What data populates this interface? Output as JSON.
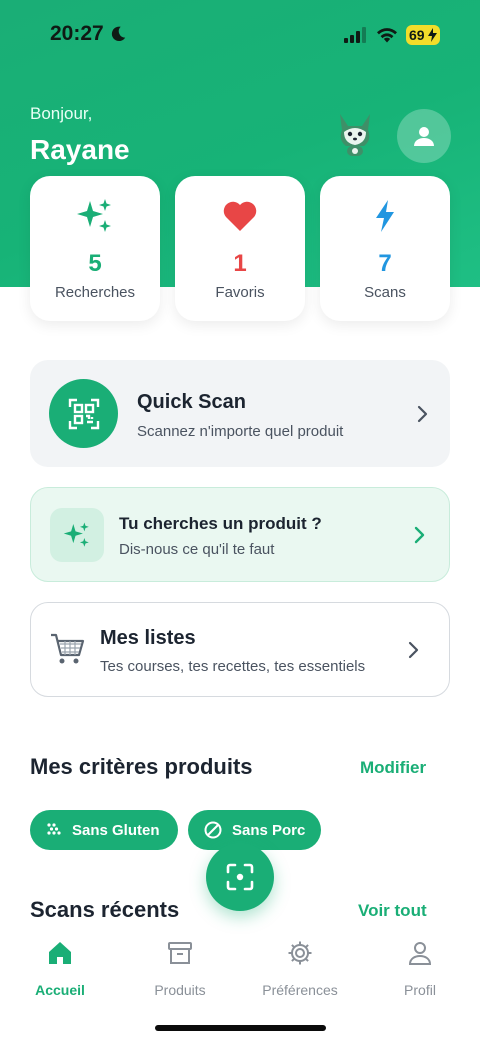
{
  "status_bar": {
    "time": "20:27",
    "battery": "69"
  },
  "header": {
    "greeting": "Bonjour,",
    "username": "Rayane"
  },
  "stats": [
    {
      "value": "5",
      "label": "Recherches",
      "icon": "sparkles-icon",
      "color": "#1aae76"
    },
    {
      "value": "1",
      "label": "Favoris",
      "icon": "heart-icon",
      "color": "#e84646"
    },
    {
      "value": "7",
      "label": "Scans",
      "icon": "lightning-icon",
      "color": "#2196e0"
    }
  ],
  "quick_scan": {
    "title": "Quick Scan",
    "subtitle": "Scannez n'importe quel produit"
  },
  "ask_product": {
    "title": "Tu cherches un produit ?",
    "subtitle": "Dis-nous ce qu'il te faut"
  },
  "my_lists": {
    "title": "Mes listes",
    "subtitle": "Tes courses, tes recettes, tes essentiels"
  },
  "criteria": {
    "title": "Mes critères produits",
    "edit_label": "Modifier",
    "chips": [
      {
        "label": "Sans Gluten",
        "icon": "gluten-free-icon"
      },
      {
        "label": "Sans Porc",
        "icon": "no-symbol-icon"
      }
    ]
  },
  "recent_scans": {
    "title": "Scans récents",
    "see_all_label": "Voir tout"
  },
  "tabs": [
    {
      "label": "Accueil",
      "icon": "home-icon",
      "active": true
    },
    {
      "label": "Produits",
      "icon": "archive-box-icon",
      "active": false
    },
    {
      "label": "Préférences",
      "icon": "gear-icon",
      "active": false
    },
    {
      "label": "Profil",
      "icon": "user-icon",
      "active": false
    }
  ],
  "colors": {
    "brand": "#1aae76",
    "favorite": "#e84646",
    "scan": "#2196e0"
  }
}
